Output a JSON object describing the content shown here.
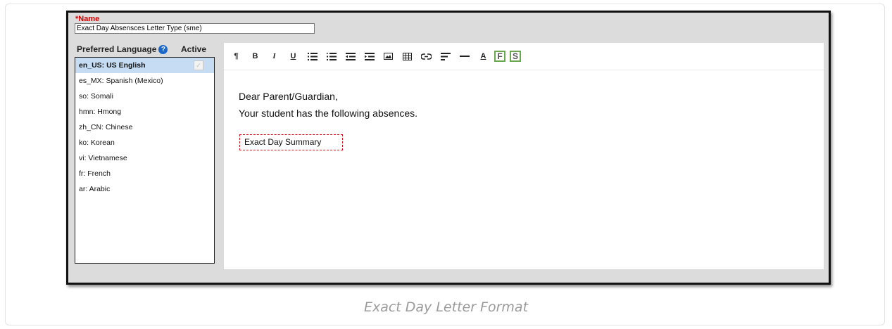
{
  "form": {
    "name_label": "*Name",
    "name_value": "Exact Day Absensces Letter Type (sme)"
  },
  "languages": {
    "header": "Preferred Language",
    "help_icon": "?",
    "active_header": "Active",
    "items": [
      {
        "label": "en_US: US English",
        "selected": true
      },
      {
        "label": "es_MX: Spanish (Mexico)"
      },
      {
        "label": "so: Somali"
      },
      {
        "label": "hmn: Hmong"
      },
      {
        "label": "zh_CN: Chinese"
      },
      {
        "label": "ko: Korean"
      },
      {
        "label": "vi: Vietnamese"
      },
      {
        "label": "fr: French"
      },
      {
        "label": "ar: Arabic"
      }
    ],
    "active_check": "✓"
  },
  "toolbar": {
    "paragraph": "¶",
    "bold": "B",
    "italic": "I",
    "underline": "U",
    "font_color": "A",
    "field": "F",
    "subreport": "S"
  },
  "editor": {
    "line1": "Dear Parent/Guardian,",
    "line2": "Your student has the following absences.",
    "summary": "Exact Day Summary"
  },
  "caption": "Exact Day Letter Format",
  "colors": {
    "selected_bg": "#c5dcf3",
    "required": "#d40000",
    "help": "#1b66c9",
    "summary_border": "#d0101a",
    "fs_border": "#6aa84f"
  }
}
